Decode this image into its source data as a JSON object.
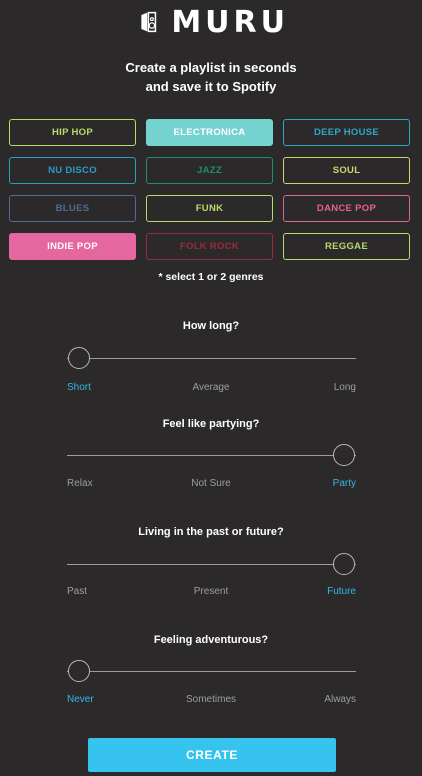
{
  "app": {
    "name": "MURU",
    "tagline_line1": "Create a playlist in seconds",
    "tagline_line2": "and save it to Spotify"
  },
  "genres": [
    {
      "label": "HIP HOP",
      "color": "#b6dc6b",
      "selected": false
    },
    {
      "label": "ELECTRONICA",
      "color": "#74d3cf",
      "selected": true
    },
    {
      "label": "DEEP HOUSE",
      "color": "#2fa6c8",
      "selected": false
    },
    {
      "label": "NU DISCO",
      "color": "#2a9ec4",
      "selected": false
    },
    {
      "label": "JAZZ",
      "color": "#1f8e6e",
      "selected": false
    },
    {
      "label": "SOUL",
      "color": "#c8d96a",
      "selected": false
    },
    {
      "label": "BLUES",
      "color": "#4d6e92",
      "selected": false
    },
    {
      "label": "FUNK",
      "color": "#b6dc6b",
      "selected": false
    },
    {
      "label": "DANCE POP",
      "color": "#e2648e",
      "selected": false
    },
    {
      "label": "INDIE POP",
      "color": "#e5679f",
      "selected": true
    },
    {
      "label": "FOLK ROCK",
      "color": "#9a2b3a",
      "selected": false
    },
    {
      "label": "REGGAE",
      "color": "#b6dc6b",
      "selected": false
    }
  ],
  "genre_note": "* select 1 or 2 genres",
  "questions": [
    {
      "title": "How long?",
      "labels": [
        "Short",
        "Average",
        "Long"
      ],
      "value": 0
    },
    {
      "title": "Feel like partying?",
      "labels": [
        "Relax",
        "Not Sure",
        "Party"
      ],
      "value": 2
    },
    {
      "title": "Living in the past or future?",
      "labels": [
        "Past",
        "Present",
        "Future"
      ],
      "value": 2
    },
    {
      "title": "Feeling adventurous?",
      "labels": [
        "Never",
        "Sometimes",
        "Always"
      ],
      "value": 0
    }
  ],
  "create_label": "CREATE",
  "colors": {
    "background": "#2b2929",
    "accent": "#36c3ee",
    "active_label": "#34b8e6"
  }
}
